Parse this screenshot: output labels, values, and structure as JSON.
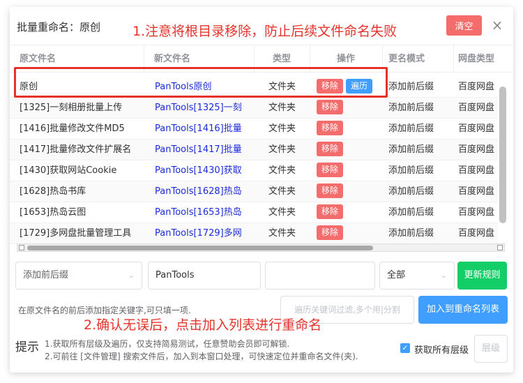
{
  "dialog": {
    "title": "批量重命名：原创",
    "clear_label": "清空",
    "close_icon": "×"
  },
  "annotations": {
    "top": "1.注意将根目录移除，防止后续文件命名失败",
    "bottom": "2.确认无误后，点击加入列表进行重命名"
  },
  "table": {
    "headers": [
      "原文件名",
      "新文件名",
      "类型",
      "操作",
      "更名模式",
      "网盘类型"
    ],
    "remove_label": "移除",
    "traverse_label": "遍历",
    "rows": [
      {
        "orig": "原创",
        "new": "PanTools原创",
        "type": "文件夹",
        "mode": "添加前后缀",
        "disk": "百度网盘"
      },
      {
        "orig": "[1325]一刻相册批量上传",
        "new": "PanTools[1325]一刻",
        "type": "文件夹",
        "mode": "添加前后缀",
        "disk": "百度网盘"
      },
      {
        "orig": "[1416]批量修改文件MD5",
        "new": "PanTools[1416]批量",
        "type": "文件夹",
        "mode": "添加前后缀",
        "disk": "百度网盘"
      },
      {
        "orig": "[1417]批量修改文件扩展名",
        "new": "PanTools[1417]批量",
        "type": "文件夹",
        "mode": "添加前后缀",
        "disk": "百度网盘"
      },
      {
        "orig": "[1430]获取网站Cookie",
        "new": "PanTools[1430]获取",
        "type": "文件夹",
        "mode": "添加前后缀",
        "disk": "百度网盘"
      },
      {
        "orig": "[1628]热岛书库",
        "new": "PanTools[1628]热岛",
        "type": "文件夹",
        "mode": "添加前后缀",
        "disk": "百度网盘"
      },
      {
        "orig": "[1653]热岛云图",
        "new": "PanTools[1653]热岛",
        "type": "文件夹",
        "mode": "添加前后缀",
        "disk": "百度网盘"
      },
      {
        "orig": "[1729]多网盘批量管理工具",
        "new": "PanTools[1729]多网",
        "type": "文件夹",
        "mode": "添加前后缀",
        "disk": "百度网盘"
      }
    ]
  },
  "controls": {
    "mode_select": "添加前后缀",
    "prefix_value": "PanTools",
    "suffix_value": "",
    "scope_select": "全部",
    "update_rule_label": "更新规则",
    "hint": "在原文件名的前后添加指定关键字,可只填一项.",
    "filter_placeholder": "遍历关键词过滤,多个用|分割",
    "add_label": "加入到重命名列表"
  },
  "tips": {
    "title": "提示",
    "line1": "1.获取所有层级及遍历，仅支持简易测试，任意赞助会员即可解锁.",
    "line2": "2.可前往 [文件管理] 搜索文件后，加入到本窗口处理，可快速定位并重命名文件(夹).",
    "checkbox_label": "获取所有层级",
    "level_label": "层级"
  },
  "colors": {
    "danger": "#f56c6c",
    "primary": "#409eff",
    "success": "#13ce66",
    "annotation": "#e5332a",
    "link": "#1a2bd9"
  }
}
